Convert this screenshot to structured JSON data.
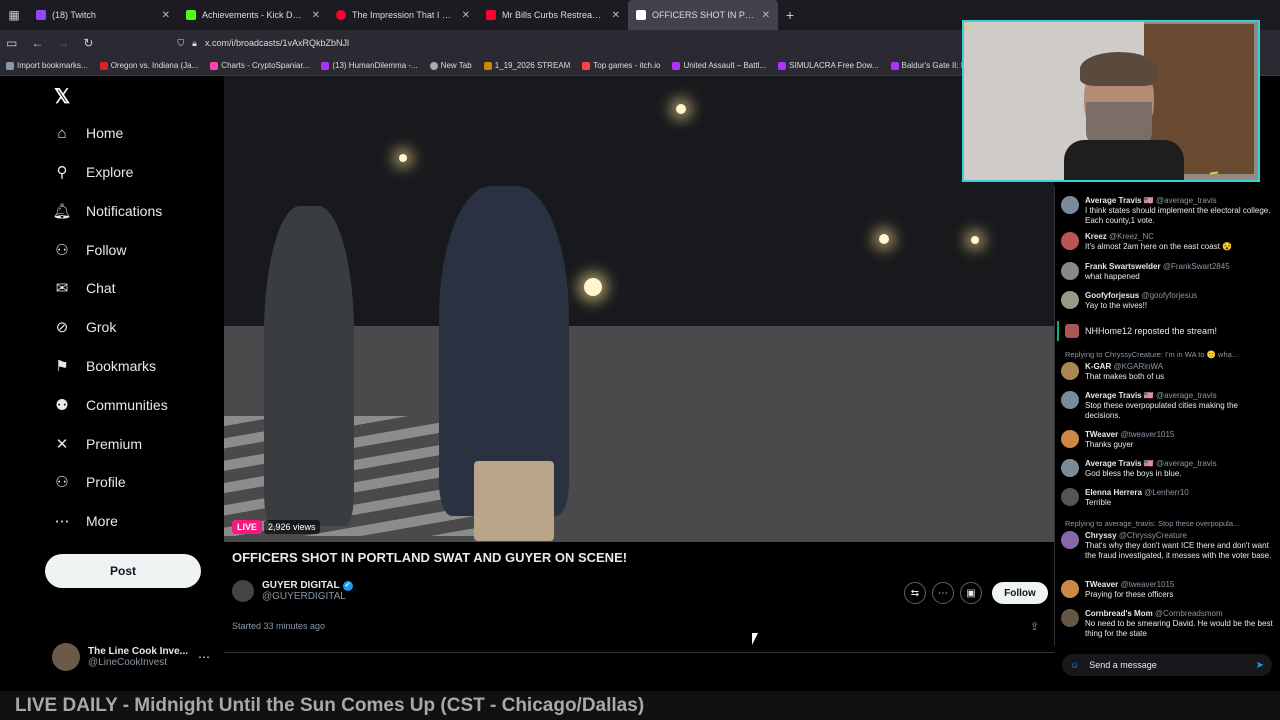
{
  "browser": {
    "tabs": [
      {
        "title": "(18) Twitch",
        "color": "#9146ff"
      },
      {
        "title": "Achievements - Kick Dashboard",
        "color": "#53fc18"
      },
      {
        "title": "The Impression That I Get (",
        "color": "#ff0033"
      },
      {
        "title": "Mr Bills Curbs Restream Show/",
        "color": "#ff0033"
      },
      {
        "title": "OFFICERS SHOT IN PORTLA",
        "color": "#ffffff",
        "active": true
      }
    ],
    "url": "x.com/i/broadcasts/1vAxRQkbZbNJl",
    "bookmarks": [
      {
        "label": "Import bookmarks...",
        "color": "#8b98a5"
      },
      {
        "label": "Oregon vs. Indiana (Ja...",
        "color": "#d22"
      },
      {
        "label": "Charts - CryptoSpaniar...",
        "color": "#f4a"
      },
      {
        "label": "(13) HumanDilemma -...",
        "color": "#a3f"
      },
      {
        "label": "New Tab",
        "color": "#aaa"
      },
      {
        "label": "1_19_2026 STREAM",
        "color": "#c80"
      },
      {
        "label": "Top games - itch.io",
        "color": "#f44"
      },
      {
        "label": "United Assault – Battl...",
        "color": "#a3f"
      },
      {
        "label": "SIMULACRA Free Dow...",
        "color": "#a3f"
      },
      {
        "label": "Baldur's Gate II: Enhan...",
        "color": "#a3f"
      }
    ]
  },
  "nav": {
    "items": [
      {
        "label": "Home",
        "icon": "⌂"
      },
      {
        "label": "Explore",
        "icon": "⚲"
      },
      {
        "label": "Notifications",
        "icon": "🔔︎"
      },
      {
        "label": "Follow",
        "icon": "⚇"
      },
      {
        "label": "Chat",
        "icon": "✉"
      },
      {
        "label": "Grok",
        "icon": "⊘"
      },
      {
        "label": "Bookmarks",
        "icon": "⚑"
      },
      {
        "label": "Communities",
        "icon": "⚉"
      },
      {
        "label": "Premium",
        "icon": "✕"
      },
      {
        "label": "Profile",
        "icon": "⚇"
      },
      {
        "label": "More",
        "icon": "⋯"
      }
    ],
    "post_label": "Post",
    "account": {
      "name": "The Line Cook Inve...",
      "handle": "@LineCookInvest"
    }
  },
  "broadcast": {
    "live_label": "LIVE",
    "views": "2,926 views",
    "title": "OFFICERS SHOT IN PORTLAND SWAT AND GUYER ON SCENE!",
    "channel_name": "GUYER DIGITAL",
    "channel_handle": "@GUYERDIGITAL",
    "follow_label": "Follow",
    "started": "Started 33 minutes ago"
  },
  "chat": {
    "messages": [
      {
        "name": "Average Travis 🇺🇸",
        "handle": "@average_travis",
        "text": "I think states should implement the electoral college. Each county,1 vote."
      },
      {
        "name": "Kreez",
        "handle": "@Kreez_NC",
        "text": "It's almost 2am here on the east coast 😵"
      },
      {
        "name": "Frank Swartswelder",
        "handle": "@FrankSwart2845",
        "text": "what happened"
      },
      {
        "name": "Goofyforjesus",
        "handle": "@goofyforjesus",
        "text": "Yay to the wives!!"
      },
      {
        "name": "K-GAR",
        "handle": "@KGARinWA",
        "text": "That makes both of us"
      },
      {
        "name": "Average Travis 🇺🇸",
        "handle": "@average_travis",
        "text": "Stop these overpopulated cities making the decisions."
      },
      {
        "name": "TWeaver",
        "handle": "@tweaver1015",
        "text": "Thanks guyer"
      },
      {
        "name": "Average Travis 🇺🇸",
        "handle": "@average_travis",
        "text": "God bless the boys in blue."
      },
      {
        "name": "Elenna Herrera",
        "handle": "@Lenherr10",
        "text": "Terrible"
      },
      {
        "name": "Chryssy",
        "handle": "@ChryssyCreature",
        "text": "That's why they don't want ICE there and don't want the fraud investigated, it messes with the voter base."
      },
      {
        "name": "TWeaver",
        "handle": "@tweaver1015",
        "text": "Praying for these officers"
      },
      {
        "name": "Cornbread's Mom",
        "handle": "@Cornbreadsmom",
        "text": "No need to be smearing David. He would be the best thing for the state"
      }
    ],
    "repost": "NHHome12 reposted the stream!",
    "reply1": "Replying to ChryssyCreature: I'm in WA to 🙂 wha...",
    "reply2": "Replying to average_travis: Stop these overpopula...",
    "input_placeholder": "Send a message"
  },
  "ticker": "LIVE DAILY - Midnight Until the Sun Comes Up (CST - Chicago/Dallas)"
}
